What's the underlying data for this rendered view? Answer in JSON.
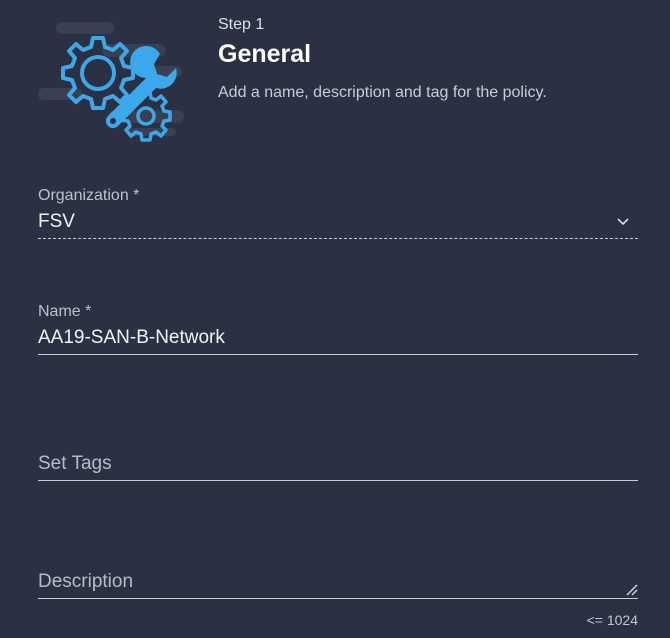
{
  "header": {
    "step": "Step 1",
    "title": "General",
    "description": "Add a name, description and tag for the policy."
  },
  "form": {
    "organization": {
      "label": "Organization *",
      "value": "FSV"
    },
    "name": {
      "label": "Name *",
      "value": "AA19-SAN-B-Network"
    },
    "tags": {
      "placeholder": "Set Tags"
    },
    "description": {
      "placeholder": "Description",
      "limit": "<= 1024"
    }
  },
  "icons": {
    "hero": "gears-wrench-icon",
    "dropdown": "chevron-down-icon",
    "resize": "resize-handle-icon"
  },
  "colors": {
    "background": "#2b3042",
    "accent": "#3aa8ea",
    "cloud": "#3a4052"
  }
}
